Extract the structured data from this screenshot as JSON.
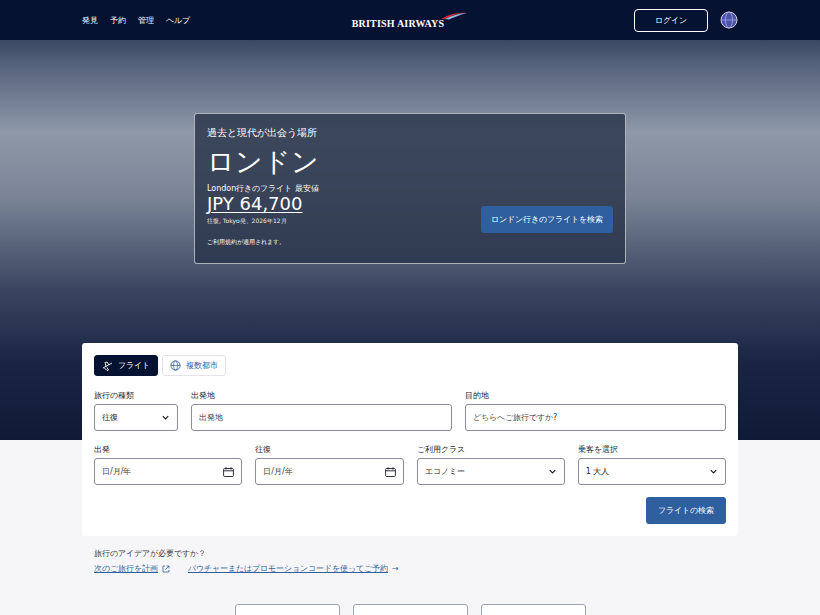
{
  "nav": {
    "items": [
      "発見",
      "予約",
      "管理",
      "ヘルプ"
    ],
    "logo": "BRITISH AIRWAYS",
    "login": "ログイン"
  },
  "hero": {
    "tagline": "過去と現代が出会う場所",
    "city": "ロンドン",
    "fare_label": "London行きのフライト 最安値",
    "price": "JPY 64,700",
    "fare_note": "往復, Tokyo発、2026年12月",
    "terms": "ご利用規約が適用されます。",
    "cta": "ロンドン行きのフライトを検索"
  },
  "search": {
    "tabs": [
      {
        "label": "フライト",
        "selected": true
      },
      {
        "label": "複数都市",
        "selected": false
      }
    ],
    "fields": [
      {
        "label": "旅行の種類",
        "kind": "select",
        "value": "往復"
      },
      {
        "label": "出発地",
        "kind": "input",
        "placeholder": "出発地"
      },
      {
        "label": "目的地",
        "kind": "input",
        "placeholder": "どちらへご旅行ですか?"
      },
      {
        "label": "出発",
        "kind": "date",
        "placeholder": "日/月/年"
      },
      {
        "label": "往復",
        "kind": "date",
        "placeholder": "日/月/年"
      },
      {
        "label": "ご利用クラス",
        "kind": "select",
        "value": "エコノミー"
      },
      {
        "label": "乗客を選択",
        "kind": "select",
        "value": "1 大人"
      }
    ],
    "submit": "フライトの検索"
  },
  "ideas": {
    "title": "旅行のアイデアが必要ですか？",
    "links": [
      {
        "label": "次のご旅行を計画",
        "kind": "external"
      },
      {
        "label": "バウチャーまたはプロモーションコードを使ってご予約",
        "kind": "arrow",
        "arrow": "→"
      }
    ]
  }
}
